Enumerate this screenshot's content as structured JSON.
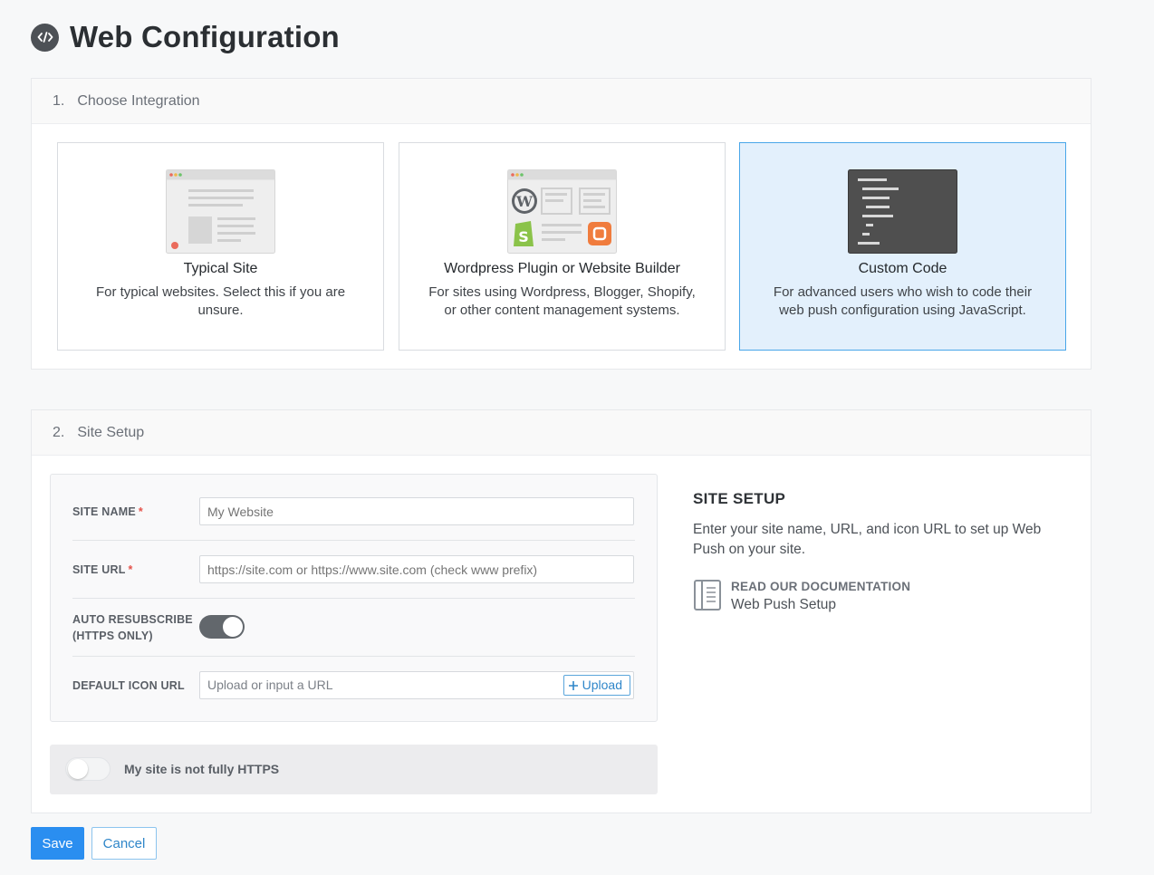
{
  "header": {
    "title": "Web Configuration",
    "icon": "code-icon"
  },
  "step1": {
    "number": "1.",
    "title": "Choose Integration",
    "cards": [
      {
        "title": "Typical Site",
        "description": "For typical websites. Select this if you are unsure.",
        "selected": false,
        "icon": "browser-illustration"
      },
      {
        "title": "Wordpress Plugin or Website Builder",
        "description": "For sites using Wordpress, Blogger, Shopify, or other content management systems.",
        "selected": false,
        "icon": "cms-illustration"
      },
      {
        "title": "Custom Code",
        "description": "For advanced users who wish to code their web push configuration using JavaScript.",
        "selected": true,
        "icon": "code-editor-illustration"
      }
    ]
  },
  "step2": {
    "number": "2.",
    "title": "Site Setup",
    "form": {
      "site_name": {
        "label": "SITE NAME",
        "required_mark": "*",
        "placeholder": "My Website",
        "value": ""
      },
      "site_url": {
        "label": "SITE URL",
        "required_mark": "*",
        "placeholder": "https://site.com or https://www.site.com (check www prefix)",
        "value": ""
      },
      "auto_resubscribe": {
        "label_line1": "AUTO RESUBSCRIBE",
        "label_line2": "(HTTPS ONLY)",
        "enabled": true
      },
      "default_icon_url": {
        "label": "DEFAULT ICON URL",
        "placeholder": "Upload or input a URL",
        "value": "",
        "upload_label": "Upload"
      }
    },
    "https_toggle": {
      "label": "My site is not fully HTTPS",
      "enabled": false
    },
    "sidebar": {
      "title": "SITE SETUP",
      "text": "Enter your site name, URL, and icon URL to set up Web Push on your site.",
      "doc_heading": "READ OUR DOCUMENTATION",
      "doc_link": "Web Push Setup"
    }
  },
  "actions": {
    "save_label": "Save",
    "cancel_label": "Cancel"
  },
  "colors": {
    "accent": "#2a8ef0",
    "selected_card_bg": "#e3f0fc",
    "selected_card_border": "#49a6e9",
    "required": "#e5534b"
  }
}
